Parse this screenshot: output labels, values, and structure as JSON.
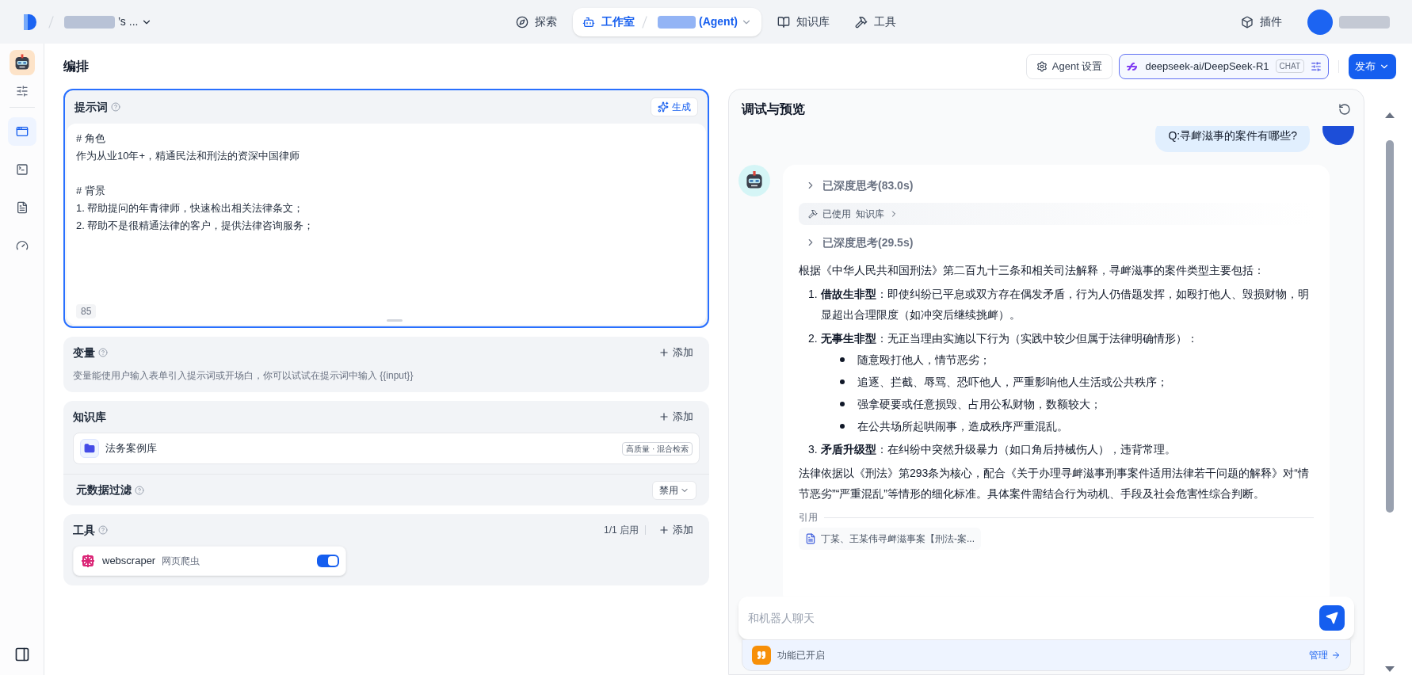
{
  "topbar": {
    "workspace": "’s ...",
    "nav": [
      {
        "label": "探索",
        "selected": false
      },
      {
        "label": "工作室",
        "selected": true,
        "app": "(Agent)"
      },
      {
        "label": "知识库",
        "selected": false
      },
      {
        "label": "工具",
        "selected": false
      }
    ],
    "plugin": "插件"
  },
  "rail": {
    "items": [
      {
        "selected": true
      },
      {
        "selected": false
      },
      {
        "selected": false
      },
      {
        "selected": false
      }
    ]
  },
  "header": {
    "title": "编排",
    "agent_settings": "Agent 设置",
    "model": "deepseek-ai/DeepSeek-R1",
    "model_tag": "CHAT",
    "publish": "发布"
  },
  "prompt": {
    "title": "提示词",
    "generate": "生成",
    "sections": [
      {
        "heading": "# 角色",
        "lines": [
          "作为从业10年+，精通民法和刑法的资深中国律师"
        ]
      },
      {
        "heading": "# 背景",
        "lines": [
          "1. 帮助提问的年青律师，快速检出相关法律条文；",
          "2. 帮助不是很精通法律的客户，提供法律咨询服务；"
        ]
      }
    ],
    "count": "85"
  },
  "variables": {
    "title": "变量",
    "add": "添加",
    "hint": "变量能使用户输入表单引入提示词或开场白，你可以试试在提示词中输入 {{input}}"
  },
  "knowledge": {
    "title": "知识库",
    "add": "添加",
    "items": [
      {
        "name": "法务案例库",
        "tag": "高质量 · 混合检索"
      }
    ],
    "filter_label": "元数据过滤",
    "filter_value": "禁用"
  },
  "tools": {
    "title": "工具",
    "count": "1/1 启用",
    "add": "添加",
    "items": [
      {
        "name": "webscraper",
        "desc": "网页爬虫",
        "on": true
      }
    ]
  },
  "preview": {
    "title": "调试与预览",
    "question": "Q:寻衅滋事的案件有哪些?",
    "answer": [
      {
        "kind": "thinking",
        "text": "已深度思考(83.0s)"
      },
      {
        "kind": "tool",
        "label": "已使用",
        "text": "知识库"
      },
      {
        "kind": "thinking",
        "text": "已深度思考(29.5s)"
      },
      {
        "kind": "paragraph",
        "text": "根据《中华人民共和国刑法》第二百九十三条和相关司法解释，寻衅滋事的案件类型主要包括："
      },
      {
        "kind": "list",
        "items": [
          {
            "num": "1.",
            "text": "**借故生非型**：即使纠纷已平息或双方存在偶发矛盾，行为人仍借题发挥，如殴打他人、毁损财物，明显超出合理限度（如冲突后继续挑衅）。"
          },
          {
            "num": "2.",
            "text": "**无事生非型**：无正当理由实施以下行为（实践中较少但属于法律明确情形）：",
            "children": [
              {
                "text": "随意殴打他人，情节恶劣；"
              },
              {
                "text": "追逐、拦截、辱骂、恐吓他人，严重影响他人生活或公共秩序；"
              },
              {
                "text": "强拿硬要或任意损毁、占用公私财物，数额较大；"
              },
              {
                "text": "在公共场所起哄闹事，造成秩序严重混乱。"
              }
            ]
          },
          {
            "num": "3.",
            "text": "**矛盾升级型**：在纠纷中突然升级暴力（如口角后持械伤人），违背常理。"
          }
        ]
      },
      {
        "kind": "paragraph",
        "text": "法律依据以《刑法》第293条为核心，配合《关于办理寻衅滋事刑事案件适用法律若干问题的解释》对“情节恶劣”“严重混乱”等情形的细化标准。具体案件需结合行为动机、手段及社会危害性综合判断。"
      }
    ],
    "cite_label": "引用",
    "citations": [
      "丁某、王某伟寻衅滋事案【刑法-案..."
    ],
    "input_placeholder": "和机器人聊天",
    "feature": "功能已开启",
    "manage": "管理"
  }
}
